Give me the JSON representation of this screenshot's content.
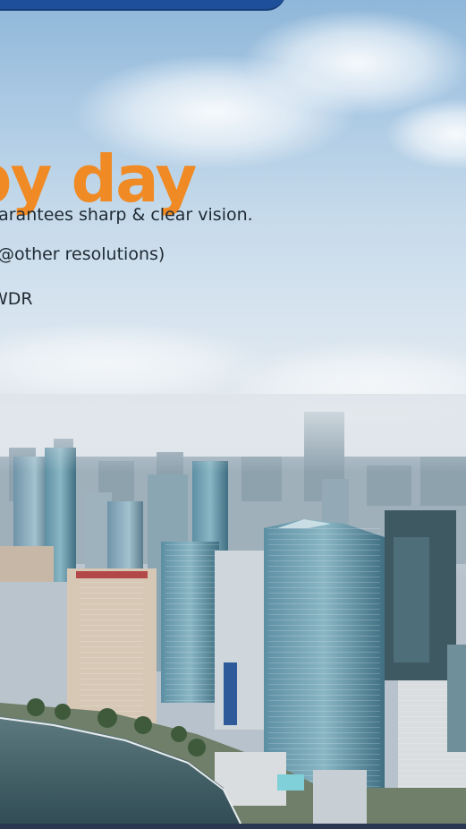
{
  "hero": {
    "headline": "by day",
    "feature_lines": [
      "guarantees sharp & clear vision.",
      "@other resolutions)",
      "WDR"
    ]
  },
  "colors": {
    "headline": "#f08a24",
    "ribbon": "#1d4f9a",
    "text": "#1f2a33"
  }
}
